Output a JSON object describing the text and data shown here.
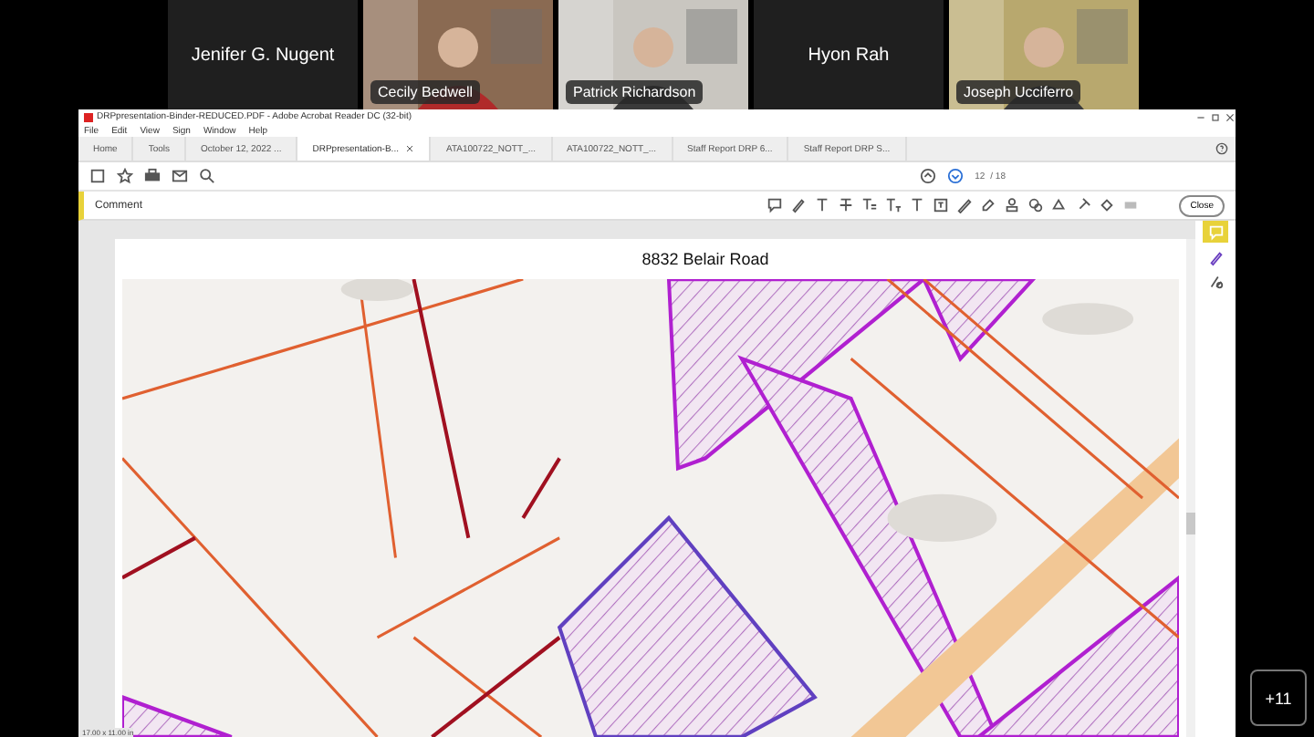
{
  "participants": [
    {
      "name": "Jenifer G. Nugent",
      "kind": "name"
    },
    {
      "name": "Cecily Bedwell",
      "kind": "video"
    },
    {
      "name": "Patrick Richardson",
      "kind": "video"
    },
    {
      "name": "Hyon Rah",
      "kind": "name"
    },
    {
      "name": "Joseph Ucciferro",
      "kind": "video"
    }
  ],
  "more_participants": "+11",
  "window": {
    "title": "DRPpresentation-Binder-REDUCED.PDF - Adobe Acrobat Reader DC (32-bit)"
  },
  "menu": [
    "File",
    "Edit",
    "View",
    "Sign",
    "Window",
    "Help"
  ],
  "tabs": [
    {
      "label": "Home",
      "selected": false
    },
    {
      "label": "Tools",
      "selected": false
    },
    {
      "label": "October 12, 2022 ...",
      "selected": false
    },
    {
      "label": "DRPpresentation-B...",
      "selected": true
    },
    {
      "label": "ATA100722_NOTT_...",
      "selected": false
    },
    {
      "label": "ATA100722_NOTT_...",
      "selected": false
    },
    {
      "label": "Staff Report DRP 6...",
      "selected": false
    },
    {
      "label": "Staff Report DRP S...",
      "selected": false
    }
  ],
  "page_nav": {
    "current": "12",
    "total": "/ 18"
  },
  "comment_bar": {
    "label": "Comment",
    "close": "Close"
  },
  "document": {
    "title": "8832 Belair Road"
  },
  "status_bar": {
    "page_size": "17.00 x 11.00 in"
  }
}
